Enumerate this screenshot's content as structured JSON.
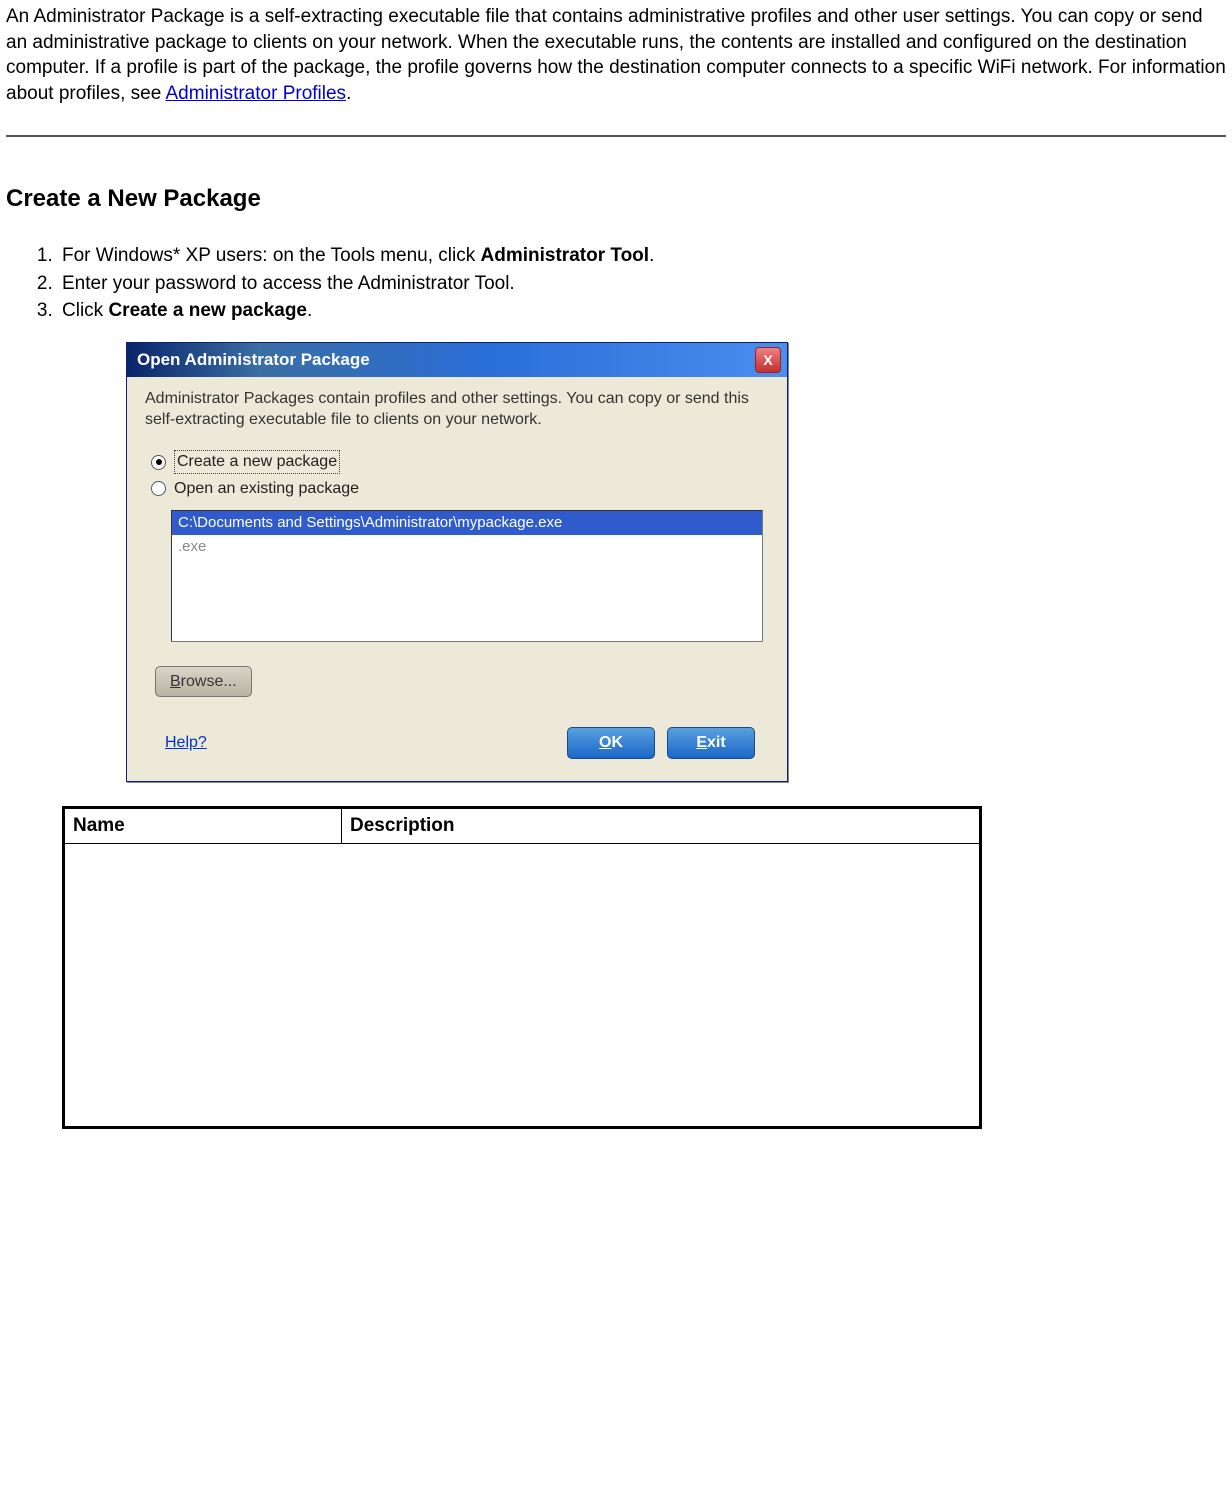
{
  "intro": {
    "text_before_link": "An Administrator Package is a self-extracting executable file that contains administrative profiles and other user settings. You can copy or send an administrative package to clients on your network. When the executable runs, the contents are installed and configured on the destination computer. If a profile is part of the package, the profile governs how the destination computer connects to a specific WiFi network. For information about profiles, see ",
    "link_text": "Administrator Profiles",
    "text_after_link": "."
  },
  "heading": "Create a New Package",
  "steps": {
    "s1_pre": "For Windows* XP users: on the Tools menu, click ",
    "s1_bold": "Administrator Tool",
    "s1_post": ".",
    "s2": "Enter your password to access the Administrator Tool.",
    "s3_pre": "Click ",
    "s3_bold": "Create a new package",
    "s3_post": "."
  },
  "dialog": {
    "title": "Open Administrator Package",
    "close": "X",
    "description": "Administrator Packages contain profiles and other settings. You can copy or send this self-extracting executable file to clients on your network.",
    "radio_create": "Create a new package",
    "radio_open": "Open an existing package",
    "list_selected": "C:\\Documents and Settings\\Administrator\\mypackage.exe",
    "list_item2": ".exe",
    "browse": "Browse...",
    "help": "Help?",
    "ok": "OK",
    "exit": "Exit"
  },
  "table": {
    "col1": "Name",
    "col2": "Description"
  }
}
